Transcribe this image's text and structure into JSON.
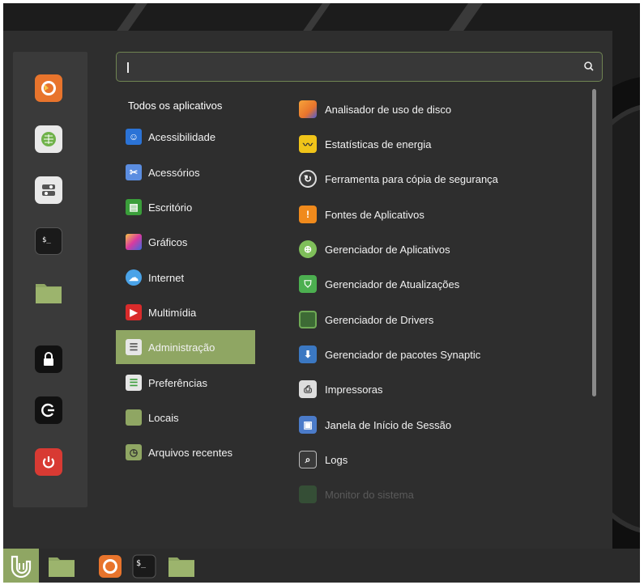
{
  "search": {
    "value": "",
    "icon": "search-icon"
  },
  "favorites": [
    {
      "name": "firefox",
      "icon": "firefox-icon",
      "color": "#e8742c"
    },
    {
      "name": "software-manager",
      "icon": "software-manager-icon",
      "color": "#e9e9e9"
    },
    {
      "name": "settings",
      "icon": "settings-icon",
      "color": "#e9e9e9"
    },
    {
      "name": "terminal",
      "icon": "terminal-icon",
      "color": "#1a1a1a"
    },
    {
      "name": "files",
      "icon": "folder-icon",
      "color": "#8fa663"
    },
    {
      "name": "lock-screen",
      "icon": "lock-icon",
      "color": "#111111"
    },
    {
      "name": "logout",
      "icon": "logout-icon",
      "color": "#111111"
    },
    {
      "name": "shutdown",
      "icon": "power-icon",
      "color": "#d83a33"
    }
  ],
  "categories": {
    "title": "Todos os aplicativos",
    "items": [
      {
        "label": "Acessibilidade",
        "icon": "accessibility-icon",
        "color": "#2b73d6"
      },
      {
        "label": "Acessórios",
        "icon": "accessories-icon",
        "color": "#5b8de0"
      },
      {
        "label": "Escritório",
        "icon": "office-icon",
        "color": "#3a9e3a"
      },
      {
        "label": "Gráficos",
        "icon": "graphics-icon",
        "color": "#c040c0"
      },
      {
        "label": "Internet",
        "icon": "internet-icon",
        "color": "#4aa3e8"
      },
      {
        "label": "Multimídia",
        "icon": "multimedia-icon",
        "color": "#d92b2b"
      },
      {
        "label": "Administração",
        "icon": "administration-icon",
        "color": "#e6e6e6",
        "selected": true
      },
      {
        "label": "Preferências",
        "icon": "preferences-icon",
        "color": "#e6e6e6"
      },
      {
        "label": "Locais",
        "icon": "folder-icon",
        "color": "#8fa663"
      },
      {
        "label": "Arquivos recentes",
        "icon": "recent-files-icon",
        "color": "#8fa663"
      }
    ]
  },
  "apps": [
    {
      "label": "Analisador de uso de disco",
      "icon": "disk-usage-icon",
      "color": "#e8742c"
    },
    {
      "label": "Estatísticas de energia",
      "icon": "power-statistics-icon",
      "color": "#f0c419"
    },
    {
      "label": "Ferramenta para cópia de segurança",
      "icon": "backup-icon",
      "color": "#3a3a3a"
    },
    {
      "label": "Fontes de Aplicativos",
      "icon": "software-sources-icon",
      "color": "#f08a1c"
    },
    {
      "label": "Gerenciador de Aplicativos",
      "icon": "software-manager-icon",
      "color": "#7fbf5a"
    },
    {
      "label": "Gerenciador de Atualizações",
      "icon": "update-manager-icon",
      "color": "#4caf50"
    },
    {
      "label": "Gerenciador de Drivers",
      "icon": "driver-manager-icon",
      "color": "#3d6b35"
    },
    {
      "label": "Gerenciador de pacotes Synaptic",
      "icon": "synaptic-icon",
      "color": "#3b78c2"
    },
    {
      "label": "Impressoras",
      "icon": "printer-icon",
      "color": "#dddddd"
    },
    {
      "label": "Janela de Início de Sessão",
      "icon": "login-window-icon",
      "color": "#4b7bc9"
    },
    {
      "label": "Logs",
      "icon": "logs-icon",
      "color": "#3a3a3a"
    },
    {
      "label": "Monitor do sistema",
      "icon": "system-monitor-icon",
      "color": "#4caf50",
      "faded": true
    }
  ],
  "panel": [
    {
      "name": "menu-button",
      "icon": "mint-logo-icon"
    },
    {
      "name": "files",
      "icon": "folder-icon"
    },
    {
      "name": "firefox",
      "icon": "firefox-icon"
    },
    {
      "name": "terminal",
      "icon": "terminal-icon"
    },
    {
      "name": "files-2",
      "icon": "folder-icon"
    }
  ]
}
